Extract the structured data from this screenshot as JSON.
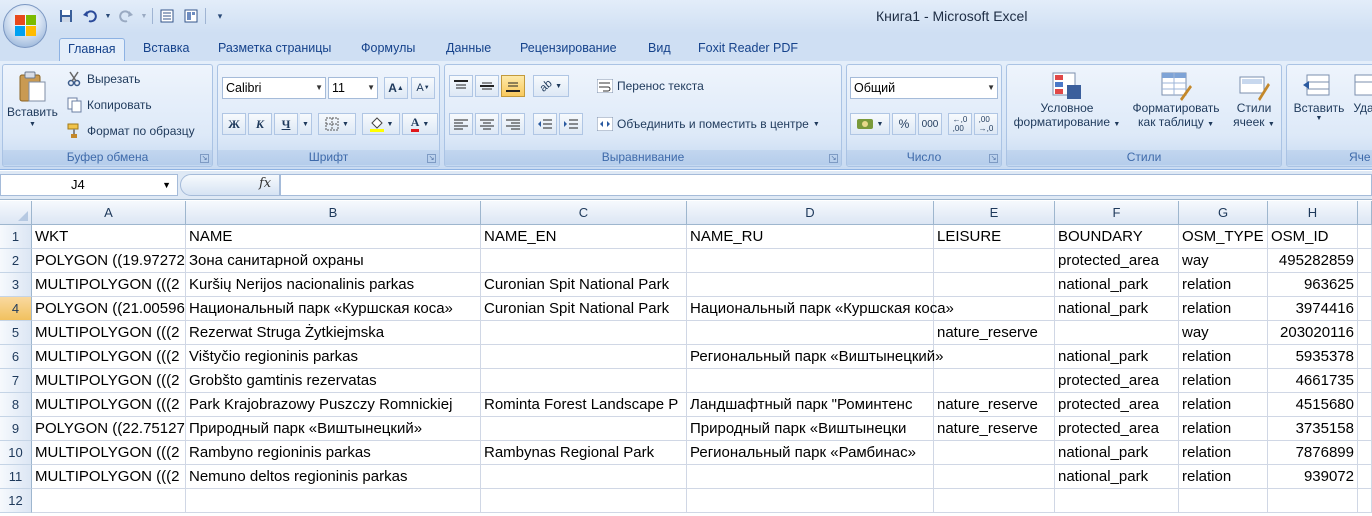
{
  "window": {
    "title": "Книга1 - Microsoft Excel"
  },
  "qat": {
    "icons": [
      "save-icon",
      "undo-icon",
      "redo-icon",
      "form-icon",
      "layout-icon",
      "customize-icon"
    ]
  },
  "tabs": [
    {
      "label": "Главная",
      "active": true
    },
    {
      "label": "Вставка"
    },
    {
      "label": "Разметка страницы"
    },
    {
      "label": "Формулы"
    },
    {
      "label": "Данные"
    },
    {
      "label": "Рецензирование"
    },
    {
      "label": "Вид"
    },
    {
      "label": "Foxit Reader PDF"
    }
  ],
  "ribbon": {
    "clipboard": {
      "label": "Буфер обмена",
      "paste": "Вставить",
      "cut": "Вырезать",
      "copy": "Копировать",
      "format_painter": "Формат по образцу"
    },
    "font": {
      "label": "Шрифт",
      "font_name": "Calibri",
      "font_size": "11",
      "bold": "Ж",
      "italic": "К",
      "underline": "Ч",
      "font_color_letter": "A"
    },
    "alignment": {
      "label": "Выравнивание",
      "wrap_text": "Перенос текста",
      "merge_center": "Объединить и поместить в центре"
    },
    "number": {
      "label": "Число",
      "format": "Общий",
      "percent": "%",
      "thousands": "000"
    },
    "styles": {
      "label": "Стили",
      "conditional_line1": "Условное",
      "conditional_line2": "форматирование",
      "table_line1": "Форматировать",
      "table_line2": "как таблицу",
      "cell_styles_line1": "Стили",
      "cell_styles_line2": "ячеек"
    },
    "cells": {
      "label": "Яче",
      "insert": "Вставить",
      "delete": "Удал"
    }
  },
  "formula_bar": {
    "name_box": "J4",
    "fx": "fx",
    "formula": ""
  },
  "sheet": {
    "active_cell": "J4",
    "columns": [
      "A",
      "B",
      "C",
      "D",
      "E",
      "F",
      "G",
      "H"
    ],
    "rows": [
      [
        "WKT",
        "NAME",
        "NAME_EN",
        "NAME_RU",
        "LEISURE",
        "BOUNDARY",
        "OSM_TYPE",
        "OSM_ID"
      ],
      [
        "POLYGON ((19.97272",
        "Зона санитарной охраны",
        "",
        "",
        "",
        "protected_area",
        "way",
        "495282859"
      ],
      [
        "MULTIPOLYGON (((2",
        "Kuršių Nerijos nacionalinis parkas",
        "Curonian Spit National Park",
        "",
        "",
        "national_park",
        "relation",
        "963625"
      ],
      [
        "POLYGON ((21.00596",
        "Национальный парк «Куршская коса»",
        "Curonian Spit National Park",
        "Национальный парк «Куршская коса»",
        "",
        "national_park",
        "relation",
        "3974416"
      ],
      [
        "MULTIPOLYGON (((2",
        "Rezerwat Struga Żytkiejmska",
        "",
        "",
        "nature_reserve",
        "",
        "way",
        "203020116"
      ],
      [
        "MULTIPOLYGON (((2",
        "Vištyčio regioninis parkas",
        "",
        "Региональный парк «Виштынецкий»",
        "",
        "national_park",
        "relation",
        "5935378"
      ],
      [
        "MULTIPOLYGON (((2",
        "Grobšto gamtinis rezervatas",
        "",
        "",
        "",
        "protected_area",
        "relation",
        "4661735"
      ],
      [
        "MULTIPOLYGON (((2",
        "Park Krajobrazowy Puszczy Romnickiej",
        "Rominta Forest Landscape P",
        "Ландшафтный парк \"Роминтенс",
        "nature_reserve",
        "protected_area",
        "relation",
        "4515680"
      ],
      [
        "POLYGON ((22.75127",
        "Природный парк «Виштынецкий»",
        "",
        "Природный парк «Виштынецки",
        "nature_reserve",
        "protected_area",
        "relation",
        "3735158"
      ],
      [
        "MULTIPOLYGON (((2",
        "Rambyno regioninis parkas",
        "Rambynas Regional Park",
        "Региональный парк «Рамбинас»",
        "",
        "national_park",
        "relation",
        "7876899"
      ],
      [
        "MULTIPOLYGON (((2",
        "Nemuno deltos regioninis parkas",
        "",
        "",
        "",
        "national_park",
        "relation",
        "939072"
      ],
      [
        "",
        "",
        "",
        "",
        "",
        "",
        "",
        ""
      ]
    ]
  }
}
